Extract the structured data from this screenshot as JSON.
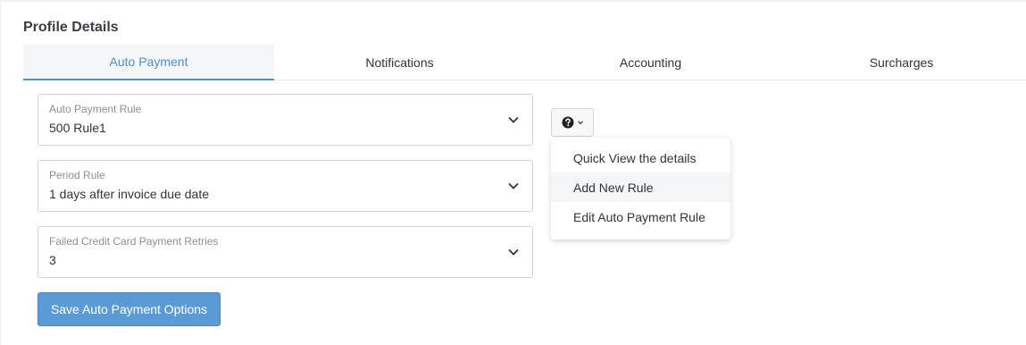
{
  "section": {
    "title": "Profile Details"
  },
  "tabs": [
    {
      "label": "Auto Payment",
      "active": true
    },
    {
      "label": "Notifications",
      "active": false
    },
    {
      "label": "Accounting",
      "active": false
    },
    {
      "label": "Surcharges",
      "active": false
    }
  ],
  "form": {
    "auto_payment_rule": {
      "label": "Auto Payment Rule",
      "value": "500 Rule1"
    },
    "period_rule": {
      "label": "Period Rule",
      "value": "1 days after invoice due date"
    },
    "failed_retries": {
      "label": "Failed Credit Card Payment Retries",
      "value": "3"
    },
    "save_label": "Save Auto Payment Options"
  },
  "help_menu": {
    "icon": "question-circle-icon",
    "items": [
      {
        "label": "Quick View the details"
      },
      {
        "label": "Add New Rule"
      },
      {
        "label": "Edit Auto Payment Rule"
      }
    ]
  },
  "colors": {
    "accent": "#4a90c9",
    "button": "#5b9bd5"
  }
}
